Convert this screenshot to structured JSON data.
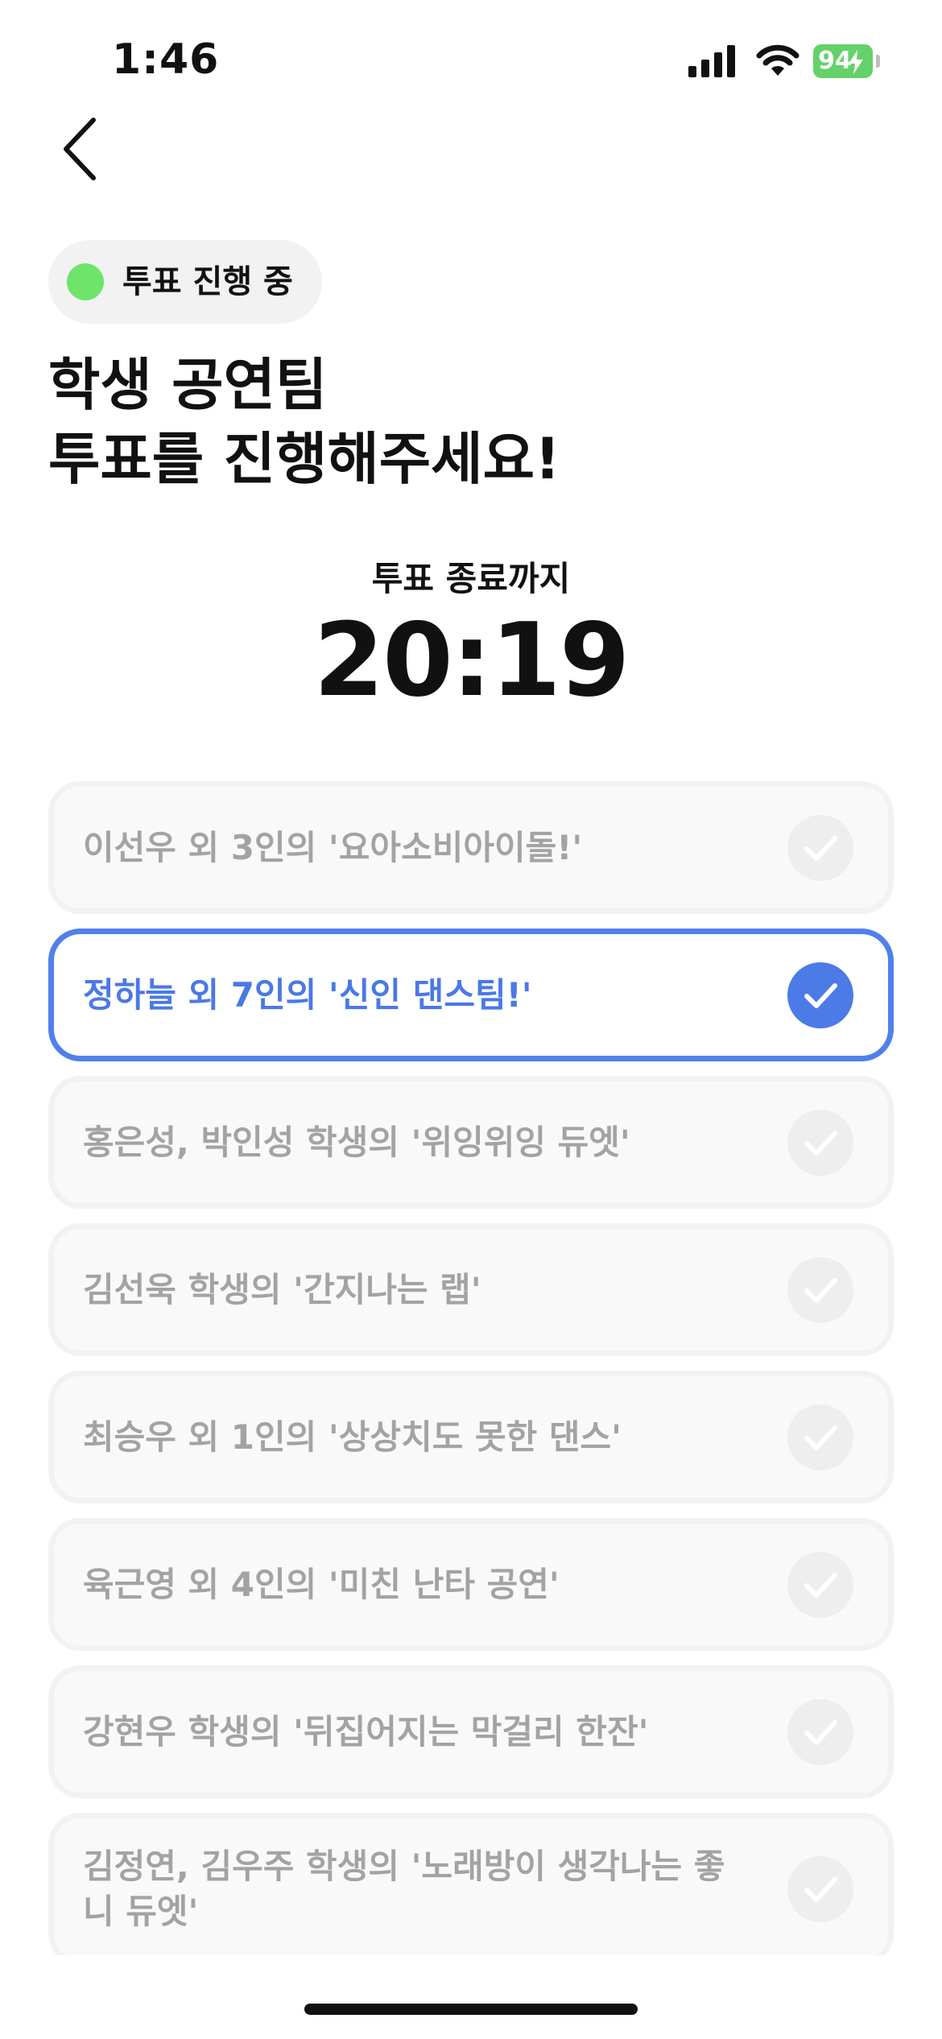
{
  "status_bar": {
    "time": "1:46",
    "battery": "94",
    "icons": [
      "signal-icon",
      "wifi-icon",
      "battery-icon",
      "charging-bolt-icon"
    ]
  },
  "nav": {
    "back_icon": "chevron-left-icon"
  },
  "vote_status": {
    "label": "투표 진행 중",
    "dot_color": "#6ee46b"
  },
  "title": {
    "line1": "학생 공연팀",
    "line2": "투표를 진행해주세요!"
  },
  "countdown": {
    "label": "투표 종료까지",
    "time": "20:19"
  },
  "colors": {
    "accent": "#4c7be8",
    "unselected_text": "#a3a3a3",
    "status_green": "#6ee46b"
  },
  "options": [
    {
      "label": "이선우 외 3인의 '요아소비아이돌!'",
      "selected": false
    },
    {
      "label": "정하늘 외 7인의 '신인 댄스팀!'",
      "selected": true
    },
    {
      "label": "홍은성, 박인성 학생의 '위잉위잉 듀엣'",
      "selected": false
    },
    {
      "label": "김선욱 학생의 '간지나는 랩'",
      "selected": false
    },
    {
      "label": "최승우 외 1인의 '상상치도 못한 댄스'",
      "selected": false
    },
    {
      "label": "육근영 외 4인의 '미친 난타 공연'",
      "selected": false
    },
    {
      "label": "강현우 학생의 '뒤집어지는 막걸리 한잔'",
      "selected": false
    },
    {
      "label": "김정연, 김우주 학생의 '노래방이 생각나는 좋니 듀엣'",
      "selected": false
    }
  ]
}
